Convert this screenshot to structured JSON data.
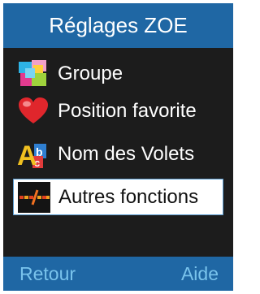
{
  "header": {
    "title": "Réglages ZOE"
  },
  "menu": {
    "items": [
      {
        "label": "Groupe",
        "icon": "group-icon"
      },
      {
        "label": "Position favorite",
        "icon": "heart-icon"
      },
      {
        "label": "Nom des Volets",
        "icon": "letters-icon"
      },
      {
        "label": "Autres fonctions",
        "icon": "functions-icon",
        "selected": true
      }
    ]
  },
  "footer": {
    "left_label": "Retour",
    "right_label": "Aide"
  },
  "colors": {
    "header_bg": "#1f67a4",
    "screen_bg": "#1c1c1c",
    "softkey_text": "#79c3ec",
    "selected_bg": "#ffffff"
  }
}
